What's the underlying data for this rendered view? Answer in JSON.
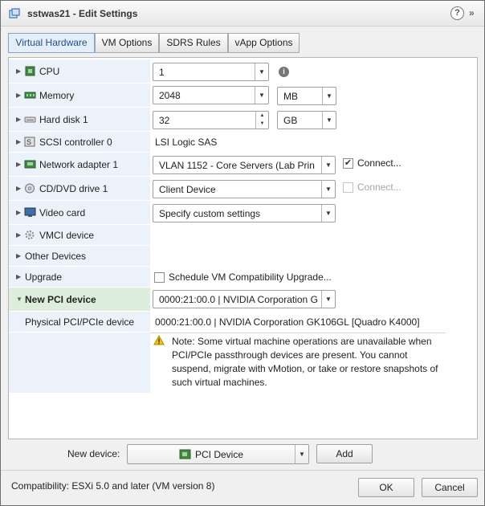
{
  "window": {
    "title": "sstwas21 - Edit Settings",
    "help_glyph": "?",
    "expand_glyph": "»"
  },
  "tabs": [
    {
      "label": "Virtual Hardware",
      "active": true
    },
    {
      "label": "VM Options",
      "active": false
    },
    {
      "label": "SDRS Rules",
      "active": false
    },
    {
      "label": "vApp Options",
      "active": false
    }
  ],
  "hardware": {
    "cpu": {
      "label": "CPU",
      "value": "1",
      "info": "i"
    },
    "memory": {
      "label": "Memory",
      "value": "2048",
      "unit": "MB"
    },
    "hard_disk": {
      "label": "Hard disk 1",
      "value": "32",
      "unit": "GB"
    },
    "scsi": {
      "label": "SCSI controller 0",
      "value": "LSI Logic SAS"
    },
    "network": {
      "label": "Network adapter 1",
      "value": "VLAN 1152 - Core Servers (Lab Prin",
      "connect_label": "Connect...",
      "connect_checked": true
    },
    "cddvd": {
      "label": "CD/DVD drive 1",
      "value": "Client Device",
      "connect_label": "Connect...",
      "connect_checked": false
    },
    "video": {
      "label": "Video card",
      "value": "Specify custom settings"
    },
    "vmci": {
      "label": "VMCI device"
    },
    "other": {
      "label": "Other Devices"
    },
    "upgrade": {
      "label": "Upgrade",
      "check_label": "Schedule VM Compatibility Upgrade...",
      "checked": false
    },
    "new_pci": {
      "label": "New PCI device",
      "value": "0000:21:00.0 | NVIDIA Corporation G"
    },
    "physical_pci": {
      "label": "Physical PCI/PCIe device",
      "value": "0000:21:00.0 | NVIDIA Corporation GK106GL [Quadro K4000]"
    },
    "note": "Note: Some virtual machine operations are unavailable when PCI/PCIe passthrough devices are present. You cannot suspend, migrate with vMotion, or take or restore snapshots of such virtual machines."
  },
  "new_device": {
    "label": "New device:",
    "value": "PCI Device",
    "add_label": "Add"
  },
  "footer": {
    "compatibility": "Compatibility: ESXi 5.0 and later (VM version 8)",
    "ok_label": "OK",
    "cancel_label": "Cancel"
  },
  "colors": {
    "active_tab": "#e3eef9",
    "label_column": "#ecf2f9",
    "selected_row": "#ddefdc",
    "warning": "#f5c400"
  }
}
